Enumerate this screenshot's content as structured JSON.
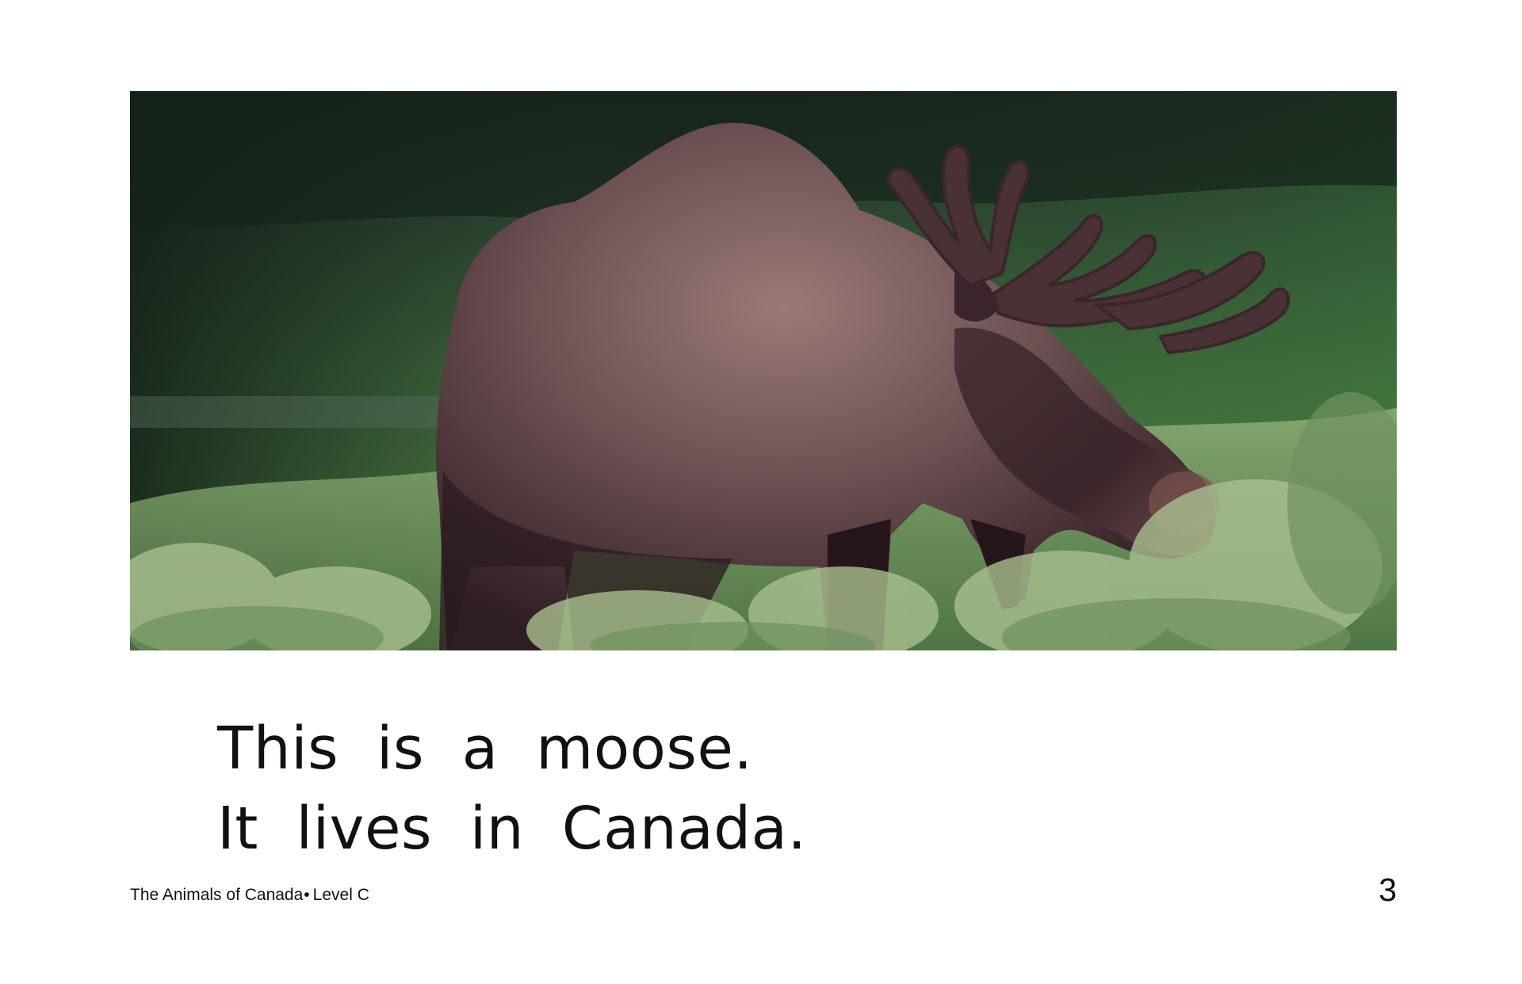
{
  "page": {
    "story_lines": [
      "This is a moose.",
      "It lives in Canada."
    ],
    "footer": {
      "book_title": "The Animals of Canada",
      "bullet": "•",
      "level": "Level C"
    },
    "page_number": "3"
  },
  "photo": {
    "subject": "moose in a green meadow",
    "colors": {
      "forest_dark": "#1d2b22",
      "meadow_green": "#3e6d3c",
      "shrub_light": "#a9bf90",
      "moose_fur": "#6e5253",
      "moose_dark": "#2b1b1f",
      "antler": "#4a3136"
    }
  }
}
